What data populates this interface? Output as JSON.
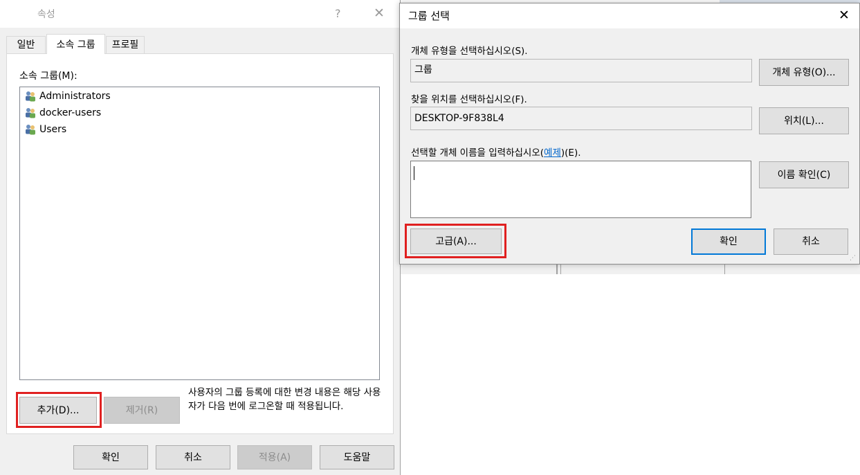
{
  "properties_window": {
    "title": "속성",
    "help_glyph": "?",
    "close_glyph": "✕",
    "tabs": [
      {
        "label": "일반"
      },
      {
        "label": "소속 그룹"
      },
      {
        "label": "프로필"
      }
    ],
    "member_label": "소속 그룹(M):",
    "member_groups": [
      {
        "name": "Administrators",
        "icon": "group-icon"
      },
      {
        "name": "docker-users",
        "icon": "group-icon"
      },
      {
        "name": "Users",
        "icon": "group-icon"
      }
    ],
    "add_button": "추가(D)...",
    "remove_button": "제거(R)",
    "notice": "사용자의 그룹 등록에 대한 변경 내용은 해당 사용자가 다음 번에 로그온할 때 적용됩니다.",
    "ok_button": "확인",
    "cancel_button": "취소",
    "apply_button": "적용(A)",
    "help_button": "도움말"
  },
  "select_group_dialog": {
    "title": "그룹 선택",
    "close_glyph": "✕",
    "object_type_label": "개체 유형을 선택하십시오(S).",
    "object_type_value": "그룹",
    "object_type_button": "개체 유형(O)...",
    "location_label": "찾을 위치를 선택하십시오(F).",
    "location_value": "DESKTOP-9F838L4",
    "location_button": "위치(L)...",
    "name_label_prefix": "선택할 개체 이름을 입력하십시오(",
    "name_label_link": "예제",
    "name_label_suffix": ")(E).",
    "name_input_value": "",
    "check_names_button": "이름 확인(C)",
    "advanced_button": "고급(A)...",
    "ok_button": "확인",
    "cancel_button": "취소"
  },
  "colors": {
    "highlight_red": "#e02020",
    "link_blue": "#0066cc",
    "default_button_border": "#0078d7"
  }
}
